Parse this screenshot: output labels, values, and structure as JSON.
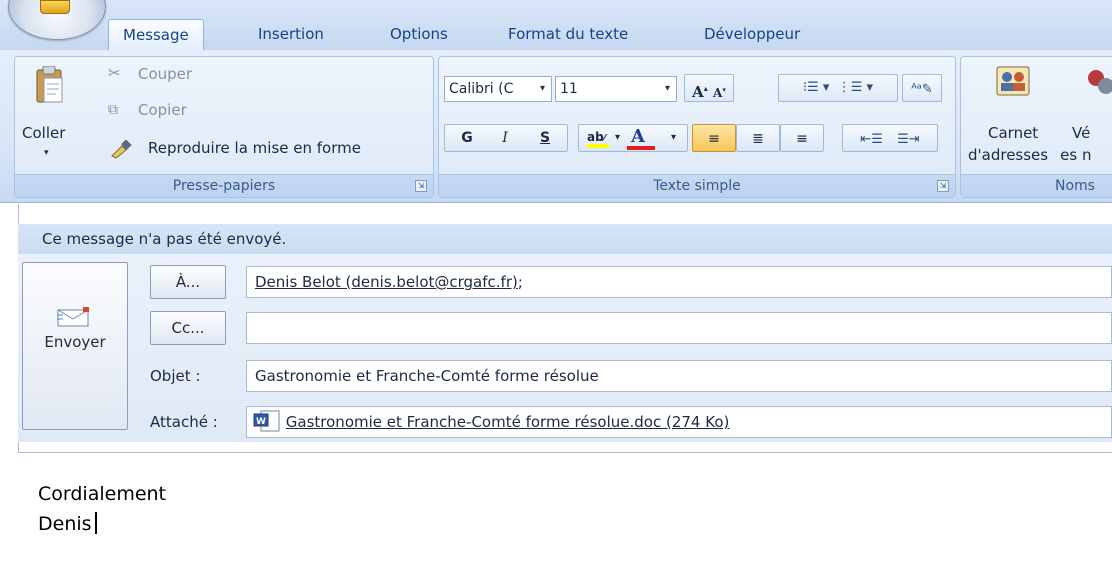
{
  "tabs": [
    {
      "label": "Message"
    },
    {
      "label": "Insertion"
    },
    {
      "label": "Options"
    },
    {
      "label": "Format du texte"
    },
    {
      "label": "Développeur"
    }
  ],
  "clipboard": {
    "paste_label": "Coller",
    "cut_label": "Couper",
    "copy_label": "Copier",
    "format_painter_label": "Reproduire la mise en forme",
    "group_label": "Presse-papiers"
  },
  "basic_text": {
    "font_name": "Calibri (C",
    "font_size": "11",
    "bold_label": "G",
    "italic_label": "I",
    "underline_label": "S",
    "group_label": "Texte simple",
    "highlight_color": "#ffff00",
    "font_color": "#e02020"
  },
  "names": {
    "address_book_line1": "Carnet",
    "address_book_line2": "d'adresses",
    "check_names_line1": "Vé",
    "check_names_line2": "les n",
    "group_label": "Noms"
  },
  "info_bar": "Ce message n'a pas été envoyé.",
  "compose": {
    "send_label": "Envoyer",
    "to_button": "À...",
    "cc_button": "Cc...",
    "to_value": "Denis Belot (denis.belot@crgafc.fr);",
    "to_name_part": "Denis Belot (denis.belot@crgafc.fr)",
    "to_separator": ";",
    "cc_value": "",
    "subject_label": "Objet :",
    "subject_value": "Gastronomie et Franche-Comté forme résolue",
    "attachment_label": "Attaché :",
    "attachment_value": "Gastronomie et Franche-Comté forme résolue.doc (274 Ko)"
  },
  "body": {
    "line1": "Cordialement",
    "line2": "Denis"
  },
  "icons": [
    "office-button-icon",
    "paste-icon",
    "scissors-icon",
    "copy-icon",
    "format-painter-icon",
    "dropdown-arrow-icon",
    "grow-font-icon",
    "shrink-font-icon",
    "bullets-icon",
    "numbering-icon",
    "styles-icon",
    "highlight-icon",
    "font-color-icon",
    "align-left-icon",
    "align-center-icon",
    "align-right-icon",
    "decrease-indent-icon",
    "increase-indent-icon",
    "address-book-icon",
    "check-names-icon",
    "send-icon",
    "word-document-icon",
    "dialog-launcher-icon"
  ]
}
